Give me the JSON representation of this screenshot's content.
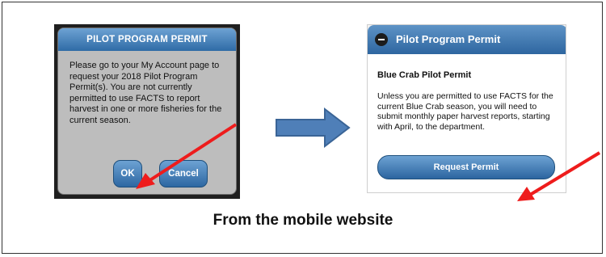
{
  "left_dialog": {
    "title": "PILOT PROGRAM PERMIT",
    "message": "Please go to your My Account page to request your 2018 Pilot Program Permit(s). You are not currently permitted to use FACTS to report harvest in one or more fisheries for the current season.",
    "ok_label": "OK",
    "cancel_label": "Cancel"
  },
  "right_panel": {
    "header": "Pilot Program Permit",
    "section_title": "Blue Crab Pilot Permit",
    "message": "Unless you are permitted to use FACTS for the current Blue Crab season, you will need to submit monthly paper harvest reports, starting with April, to the department.",
    "request_label": "Request Permit"
  },
  "caption": "From the mobile website",
  "colors": {
    "header_blue": "#2f6ba6",
    "flow_arrow": "#4f7fb8",
    "annotation_red": "#ee1c1c"
  },
  "icons": {
    "collapse": "minus-circle-icon",
    "flow": "right-arrow-icon",
    "annotation": "red-pointer-arrow-icon"
  }
}
